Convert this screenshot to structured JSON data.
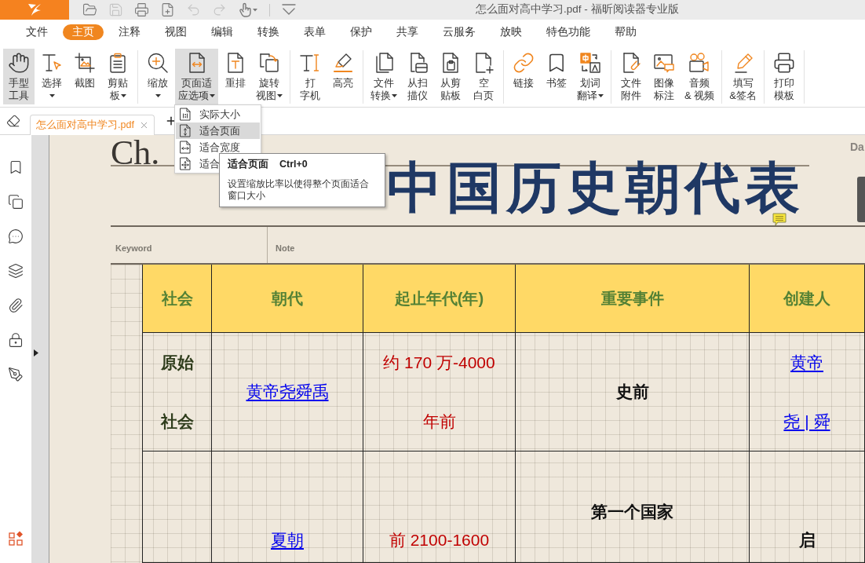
{
  "window": {
    "title": "怎么面对高中学习.pdf - 福昕阅读器专业版"
  },
  "quick_access": [
    {
      "disabled": false
    },
    {
      "disabled": true
    },
    {
      "disabled": false
    },
    {
      "disabled": false
    },
    {
      "disabled": true
    },
    {
      "disabled": true
    },
    {
      "disabled": false
    },
    {
      "disabled": false
    }
  ],
  "menu_tabs": [
    {
      "label": "文件",
      "selected": false
    },
    {
      "label": "主页",
      "selected": true
    },
    {
      "label": "注释",
      "selected": false
    },
    {
      "label": "视图",
      "selected": false
    },
    {
      "label": "编辑",
      "selected": false
    },
    {
      "label": "转换",
      "selected": false
    },
    {
      "label": "表单",
      "selected": false
    },
    {
      "label": "保护",
      "selected": false
    },
    {
      "label": "共享",
      "selected": false
    },
    {
      "label": "云服务",
      "selected": false
    },
    {
      "label": "放映",
      "selected": false
    },
    {
      "label": "特色功能",
      "selected": false
    },
    {
      "label": "帮助",
      "selected": false
    }
  ],
  "ribbon": {
    "groups": [
      {
        "buttons": [
          {
            "lines": [
              "手型",
              "工具"
            ],
            "dropdown": false,
            "selected": true
          },
          {
            "lines": [
              "选择"
            ],
            "dropdown": true,
            "selected": false
          },
          {
            "lines": [
              "截图"
            ],
            "dropdown": false,
            "selected": false
          },
          {
            "lines": [
              "剪贴",
              "板"
            ],
            "dropdown": true,
            "selected": false
          }
        ]
      },
      {
        "buttons": [
          {
            "lines": [
              "缩放"
            ],
            "dropdown": true,
            "selected": false
          },
          {
            "lines": [
              "页面适",
              "应选项"
            ],
            "dropdown": true,
            "selected": true
          },
          {
            "lines": [
              "重排"
            ],
            "dropdown": false,
            "selected": false
          },
          {
            "lines": [
              "旋转",
              "视图"
            ],
            "dropdown": true,
            "selected": false
          }
        ]
      },
      {
        "buttons": [
          {
            "lines": [
              "打",
              "字机"
            ],
            "dropdown": false,
            "selected": false
          },
          {
            "lines": [
              "高亮"
            ],
            "dropdown": false,
            "selected": false
          }
        ]
      },
      {
        "buttons": [
          {
            "lines": [
              "文件",
              "转换"
            ],
            "dropdown": true,
            "selected": false
          },
          {
            "lines": [
              "从扫",
              "描仪"
            ],
            "dropdown": false,
            "selected": false
          },
          {
            "lines": [
              "从剪",
              "贴板"
            ],
            "dropdown": false,
            "selected": false
          },
          {
            "lines": [
              "空",
              "白页"
            ],
            "dropdown": false,
            "selected": false
          }
        ]
      },
      {
        "buttons": [
          {
            "lines": [
              "链接"
            ],
            "dropdown": false,
            "selected": false
          },
          {
            "lines": [
              "书签"
            ],
            "dropdown": false,
            "selected": false
          },
          {
            "lines": [
              "划词",
              "翻译"
            ],
            "dropdown": true,
            "selected": false
          }
        ]
      },
      {
        "buttons": [
          {
            "lines": [
              "文件",
              "附件"
            ],
            "dropdown": false,
            "selected": false
          },
          {
            "lines": [
              "图像",
              "标注"
            ],
            "dropdown": false,
            "selected": false
          },
          {
            "lines": [
              "音频",
              "& 视频"
            ],
            "dropdown": false,
            "selected": false
          }
        ]
      },
      {
        "buttons": [
          {
            "lines": [
              "填写",
              "&签名"
            ],
            "dropdown": false,
            "selected": false
          }
        ]
      },
      {
        "buttons": [
          {
            "lines": [
              "打印",
              "模板"
            ],
            "dropdown": false,
            "selected": false
          }
        ]
      }
    ]
  },
  "document_tabs": [
    {
      "title": "怎么面对高中学习.pdf",
      "selected": true
    }
  ],
  "zoom_menu": {
    "items": [
      {
        "label": "实际大小",
        "selected": false
      },
      {
        "label": "适合页面",
        "selected": true
      },
      {
        "label": "适合宽度",
        "selected": false
      },
      {
        "label": "适合",
        "selected": false
      }
    ]
  },
  "tooltip": {
    "title": "适合页面",
    "shortcut": "Ctrl+0",
    "description": "设置缩放比率以使得整个页面适合窗口大小"
  },
  "document": {
    "chapter_label": "Ch.",
    "date_label": "Da",
    "title": "中国历史朝代表",
    "keyword_label": "Keyword",
    "note_label": "Note",
    "table": {
      "columns": [
        "社会",
        "朝代",
        "起止年代(年)",
        "重要事件",
        "创建人"
      ],
      "rows": [
        {
          "cells": [
            {
              "kind": "society",
              "lines": [
                "原始",
                "社会"
              ]
            },
            {
              "kind": "link",
              "lines": [
                "黄帝尧舜禹"
              ]
            },
            {
              "kind": "period",
              "lines": [
                "约 170 万-4000",
                "年前"
              ]
            },
            {
              "kind": "plain",
              "lines": [
                "史前"
              ]
            },
            {
              "kind": "link",
              "lines": [
                "黄帝",
                "尧 | 舜"
              ]
            }
          ]
        },
        {
          "cells": [
            {},
            {
              "kind": "link",
              "lines": [
                "夏朝"
              ]
            },
            {
              "kind": "period",
              "lines": [
                "前 2100-1600"
              ]
            },
            {
              "kind": "plain",
              "lines": [
                "第一个国家"
              ]
            },
            {
              "kind": "plain",
              "lines": [
                "启"
              ]
            }
          ]
        }
      ]
    }
  }
}
